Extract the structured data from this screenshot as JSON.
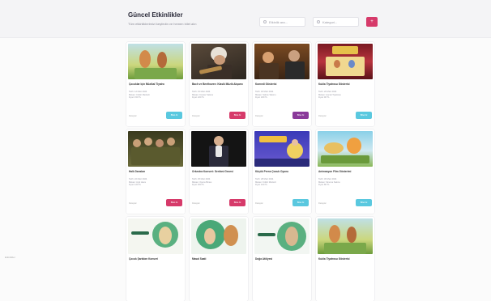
{
  "header": {
    "title": "Güncel Etkinlikler",
    "subtitle": "Tüm etkinliklerimizi keşfedin ve hemen bilet alın",
    "search_placeholder": "Etkinlik ara...",
    "category_placeholder": "Kategori...",
    "add_label": "+"
  },
  "cards": [
    {
      "title": "Çocuklar İçin Müzikal Tiyatro",
      "meta": [
        "Tarih: 12 Mart 2024",
        "Mekan: Kültür Merkezi",
        "Fiyat: 150 TL"
      ],
      "date": "Detaylar",
      "button": "Bilet Al",
      "color": "cyan"
    },
    {
      "title": "Bach ve Beethoven: Klasik Müzik Akşamı",
      "meta": [
        "Tarih: 15 Mart 2024",
        "Mekan: Konser Salonu",
        "Fiyat: 220 TL"
      ],
      "date": "Detaylar",
      "button": "Bilet Al",
      "color": "pink"
    },
    {
      "title": "Komedi Gösterisi",
      "meta": [
        "Tarih: 18 Mart 2024",
        "Mekan: Sahne Salonu",
        "Fiyat: 180 TL"
      ],
      "date": "Detaylar",
      "button": "Bilet Al",
      "color": "purple"
    },
    {
      "title": "Kukla Tiyatrosu Gösterisi",
      "meta": [
        "Tarih: 20 Mart 2024",
        "Mekan: Çocuk Tiyatrosu",
        "Fiyat: 90 TL"
      ],
      "date": "Detaylar",
      "button": "Bilet Al",
      "color": "cyan"
    },
    {
      "title": "Halk Dansları",
      "meta": [
        "Tarih: 22 Mart 2024",
        "Mekan: Açık Hava",
        "Fiyat: 120 TL"
      ],
      "date": "Detaylar",
      "button": "Bilet Al",
      "color": "pink"
    },
    {
      "title": "Orkestra Konseri: Senfoni Gecesi",
      "meta": [
        "Tarih: 25 Mart 2024",
        "Mekan: Opera Binası",
        "Fiyat: 300 TL"
      ],
      "date": "Detaylar",
      "button": "Bilet Al",
      "color": "pink"
    },
    {
      "title": "Küçük Prens Çocuk Oyunu",
      "meta": [
        "Tarih: 28 Mart 2024",
        "Mekan: Kültür Merkezi",
        "Fiyat: 100 TL"
      ],
      "date": "Detaylar",
      "button": "Bilet Al",
      "color": "cyan"
    },
    {
      "title": "Animasyon Film Gösterimi",
      "meta": [
        "Tarih: 30 Mart 2024",
        "Mekan: Sinema Salonu",
        "Fiyat: 80 TL"
      ],
      "date": "Detaylar",
      "button": "Bilet Al",
      "color": "cyan"
    },
    {
      "title": "Çocuk Şarkıları Konseri",
      "meta": [],
      "date": "",
      "button": "",
      "color": "cyan"
    },
    {
      "title": "Masal Saati",
      "meta": [],
      "date": "",
      "button": "",
      "color": "cyan"
    },
    {
      "title": "Doğa Atölyesi",
      "meta": [],
      "date": "",
      "button": "",
      "color": "cyan"
    },
    {
      "title": "Kukla Tiyatrosu Gösterisi",
      "meta": [],
      "date": "",
      "button": "",
      "color": "cyan"
    }
  ],
  "footer": {
    "left_text": "Etkinlikler"
  }
}
